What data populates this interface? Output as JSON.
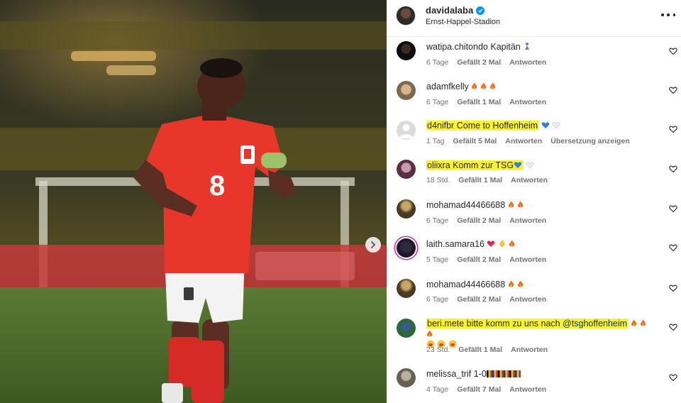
{
  "post": {
    "username": "davidalaba",
    "location": "Ernst-Happel-Stadion",
    "photo_description_icon": "soccer-player-photo",
    "jersey_number": "8"
  },
  "labels": {
    "reply": "Antworten",
    "translate": "Übersetzung anzeigen"
  },
  "comments": [
    {
      "user": "watipa.chitondo",
      "text": "Kapitän",
      "emoji": "person-emoji",
      "age": "6 Tage",
      "likes": "Gefällt 2 Mal",
      "highlighted": false
    },
    {
      "user": "adamfkelly",
      "text": "",
      "emoji": "fire-x3",
      "age": "6 Tage",
      "likes": "Gefällt 1 Mal",
      "highlighted": false
    },
    {
      "user": "d4nifbr",
      "text": "Come to Hoffenheim",
      "emoji": "blue-heart white-heart",
      "age": "1 Tag",
      "likes": "Gefällt 5 Mal",
      "translate": true,
      "highlighted": true
    },
    {
      "user": "oliixra",
      "text": "Komm zur TSG",
      "emoji": "blue-heart white-heart",
      "age": "18 Std.",
      "likes": "Gefällt 1 Mal",
      "highlighted": true
    },
    {
      "user": "mohamad44466688",
      "text": "",
      "emoji": "fire-x2",
      "age": "6 Tage",
      "likes": "Gefällt 2 Mal",
      "highlighted": false
    },
    {
      "user": "laith.samara16",
      "text": "",
      "emoji": "heart clap fire",
      "age": "5 Tage",
      "likes": "Gefällt 2 Mal",
      "highlighted": false
    },
    {
      "user": "mohamad44466688",
      "text": "",
      "emoji": "fire-x2",
      "age": "6 Tage",
      "likes": "Gefällt 2 Mal",
      "highlighted": false
    },
    {
      "user": "beri.mete",
      "text": "bitte komm zu uns nach",
      "mention": "@tsghoffenheim",
      "emoji": "fire-x3 kiss-x3",
      "age": "23 Std.",
      "likes": "Gefällt 1 Mal",
      "highlighted": true
    },
    {
      "user": "melissa_trif",
      "text": "1-0",
      "emoji": "flags",
      "age": "4 Tage",
      "likes": "Gefällt 7 Mal",
      "highlighted": false
    }
  ],
  "colors": {
    "highlight": "#fff42a",
    "verified": "#0095f6",
    "jersey": "#e8372a",
    "meta_text": "#737373"
  }
}
